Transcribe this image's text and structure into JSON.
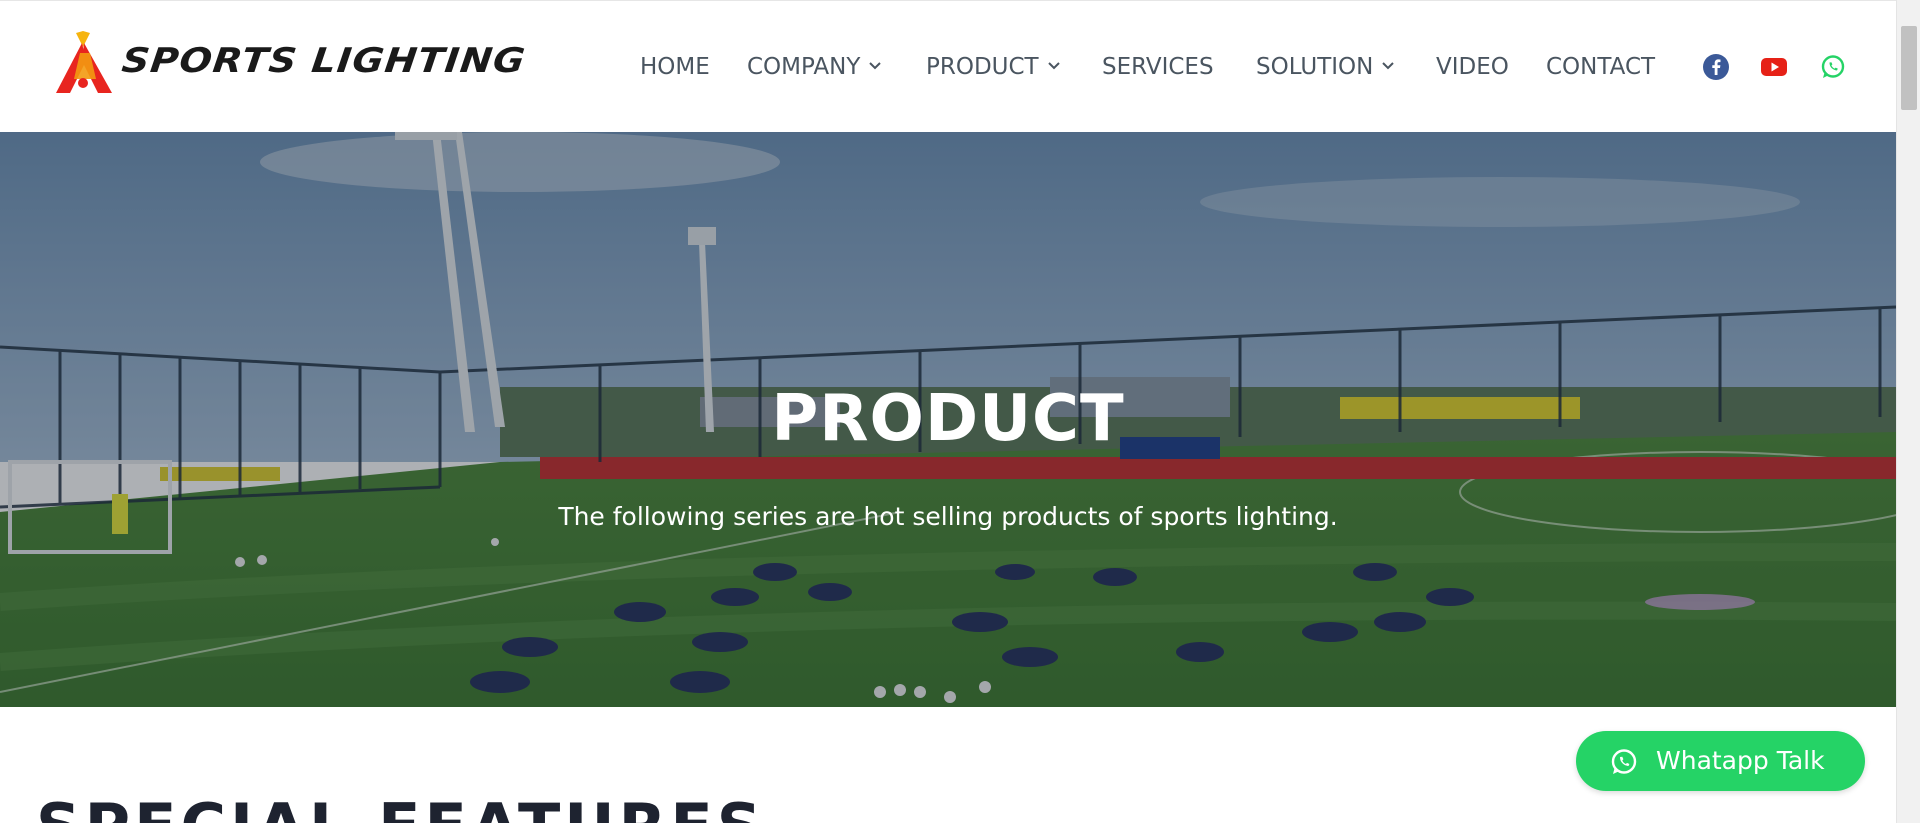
{
  "brand": {
    "name": "SPORTS LIGHTING",
    "logo_colors": [
      "#f6b40e",
      "#e8251f"
    ]
  },
  "nav": {
    "items": [
      {
        "label": "HOME",
        "dropdown": false
      },
      {
        "label": "COMPANY",
        "dropdown": true
      },
      {
        "label": "PRODUCT",
        "dropdown": true
      },
      {
        "label": "SERVICES",
        "dropdown": false
      },
      {
        "label": "SOLUTION",
        "dropdown": true
      },
      {
        "label": "VIDEO",
        "dropdown": false
      },
      {
        "label": "CONTACT",
        "dropdown": false
      }
    ],
    "text_color": "#4a5560"
  },
  "social": [
    {
      "icon": "facebook-icon",
      "color": "#3b5998"
    },
    {
      "icon": "youtube-icon",
      "color": "#e62117"
    },
    {
      "icon": "whatsapp-icon",
      "color": "#25d366"
    }
  ],
  "hero": {
    "title": "PRODUCT",
    "subtitle": "The following series are hot selling products of sports lighting."
  },
  "section": {
    "title": "SPECIAL FEATURES"
  },
  "whatsapp_button": {
    "label": "Whatapp Talk",
    "color": "#25d366"
  }
}
